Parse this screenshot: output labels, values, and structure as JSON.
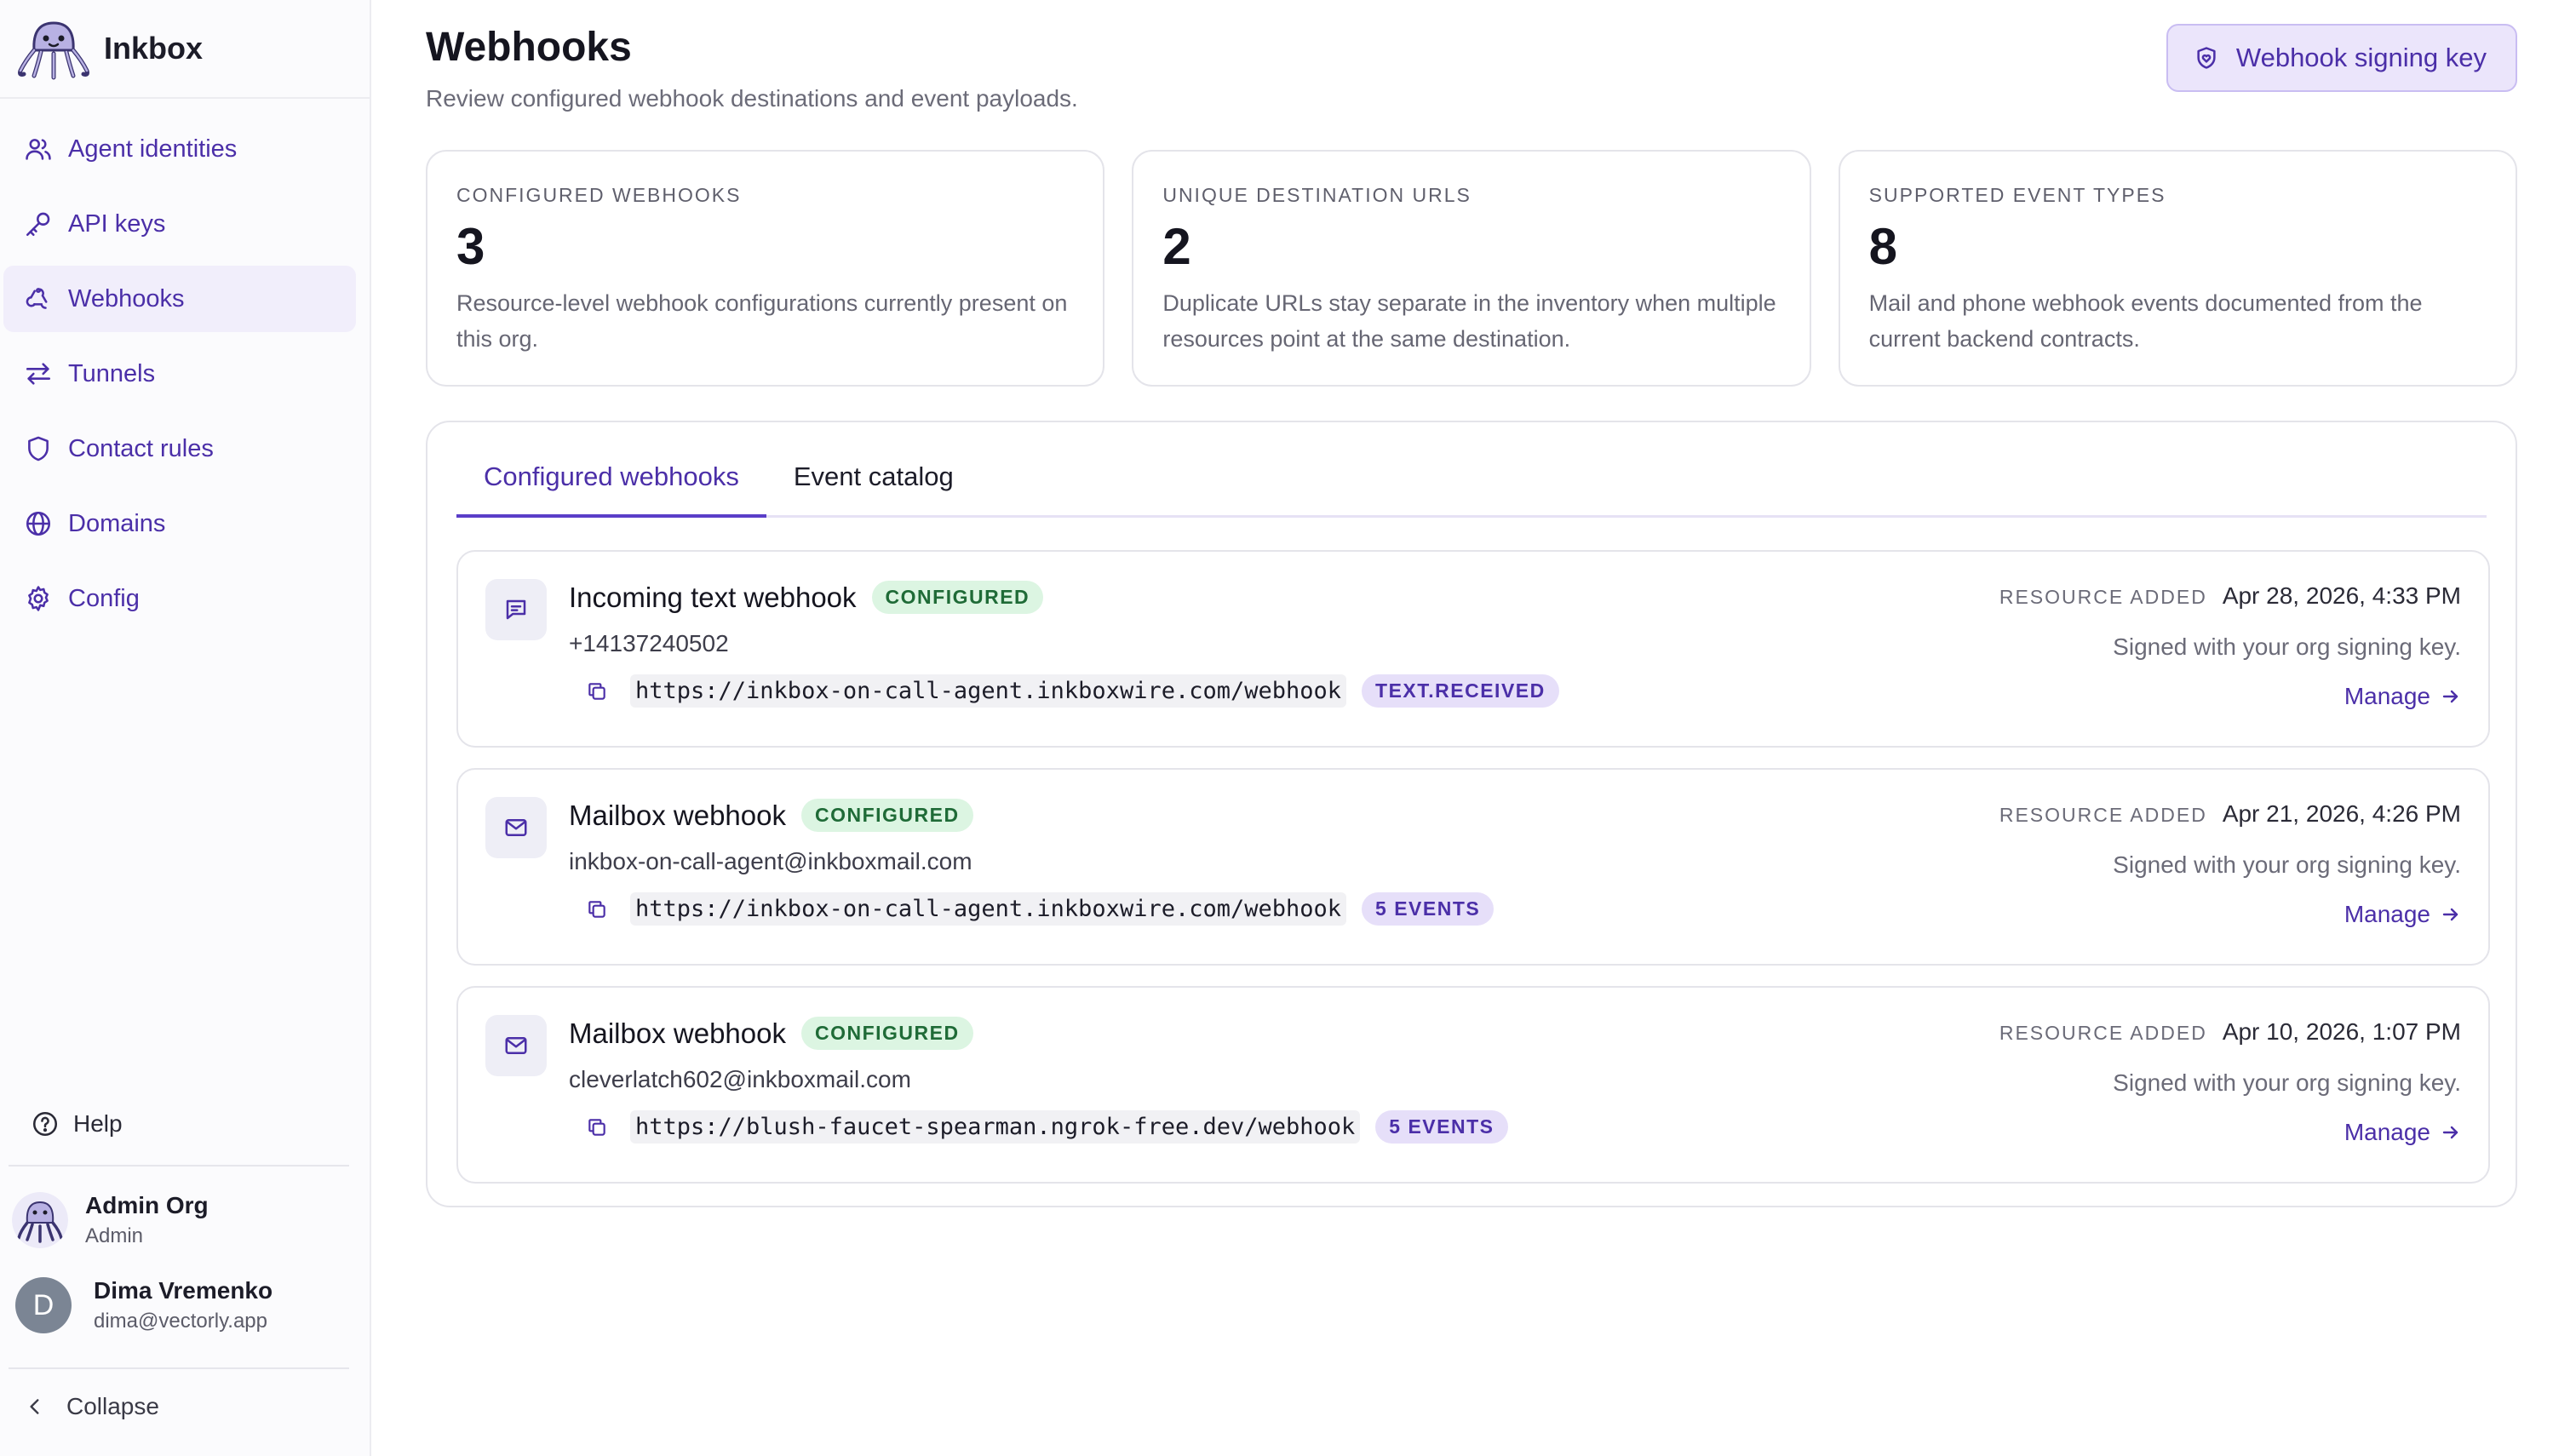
{
  "brand": {
    "name": "Inkbox",
    "logo_icon": "octopus-logo-icon"
  },
  "sidebar": {
    "items": [
      {
        "label": "Agent identities",
        "icon": "users-icon",
        "active": false
      },
      {
        "label": "API keys",
        "icon": "key-icon",
        "active": false
      },
      {
        "label": "Webhooks",
        "icon": "webhook-icon",
        "active": true
      },
      {
        "label": "Tunnels",
        "icon": "arrows-left-right-icon",
        "active": false
      },
      {
        "label": "Contact rules",
        "icon": "shield-icon",
        "active": false
      },
      {
        "label": "Domains",
        "icon": "globe-icon",
        "active": false
      },
      {
        "label": "Config",
        "icon": "gear-icon",
        "active": false
      }
    ],
    "help_label": "Help",
    "org": {
      "name": "Admin Org",
      "role": "Admin"
    },
    "user": {
      "initial": "D",
      "name": "Dima Vremenko",
      "email": "dima@vectorly.app"
    },
    "collapse_label": "Collapse"
  },
  "header": {
    "title": "Webhooks",
    "subtitle": "Review configured webhook destinations and event payloads.",
    "signing_key_button": "Webhook signing key"
  },
  "stats": [
    {
      "label": "CONFIGURED WEBHOOKS",
      "value": "3",
      "description": "Resource-level webhook configurations currently present on this org."
    },
    {
      "label": "UNIQUE DESTINATION URLS",
      "value": "2",
      "description": "Duplicate URLs stay separate in the inventory when multiple resources point at the same destination."
    },
    {
      "label": "SUPPORTED EVENT TYPES",
      "value": "8",
      "description": "Mail and phone webhook events documented from the current backend contracts."
    }
  ],
  "tabs": [
    {
      "label": "Configured webhooks",
      "active": true
    },
    {
      "label": "Event catalog",
      "active": false
    }
  ],
  "webhooks": [
    {
      "icon": "message-icon",
      "title": "Incoming text webhook",
      "status": "CONFIGURED",
      "target": "+14137240502",
      "url": "https://inkbox-on-call-agent.inkboxwire.com/webhook",
      "events_badge": "TEXT.RECEIVED",
      "added_label": "RESOURCE ADDED",
      "added_value": "Apr 28, 2026, 4:33 PM",
      "signed_text": "Signed with your org signing key.",
      "manage_label": "Manage"
    },
    {
      "icon": "mail-icon",
      "title": "Mailbox webhook",
      "status": "CONFIGURED",
      "target": "inkbox-on-call-agent@inkboxmail.com",
      "url": "https://inkbox-on-call-agent.inkboxwire.com/webhook",
      "events_badge": "5 EVENTS",
      "added_label": "RESOURCE ADDED",
      "added_value": "Apr 21, 2026, 4:26 PM",
      "signed_text": "Signed with your org signing key.",
      "manage_label": "Manage"
    },
    {
      "icon": "mail-icon",
      "title": "Mailbox webhook",
      "status": "CONFIGURED",
      "target": "cleverlatch602@inkboxmail.com",
      "url": "https://blush-faucet-spearman.ngrok-free.dev/webhook",
      "events_badge": "5 EVENTS",
      "added_label": "RESOURCE ADDED",
      "added_value": "Apr 10, 2026, 1:07 PM",
      "signed_text": "Signed with your org signing key.",
      "manage_label": "Manage"
    }
  ],
  "colors": {
    "accent": "#4b2fa8",
    "accent_bg": "#ebe5fb",
    "configured_bg": "#dcf5e2",
    "configured_text": "#1f6b37"
  }
}
